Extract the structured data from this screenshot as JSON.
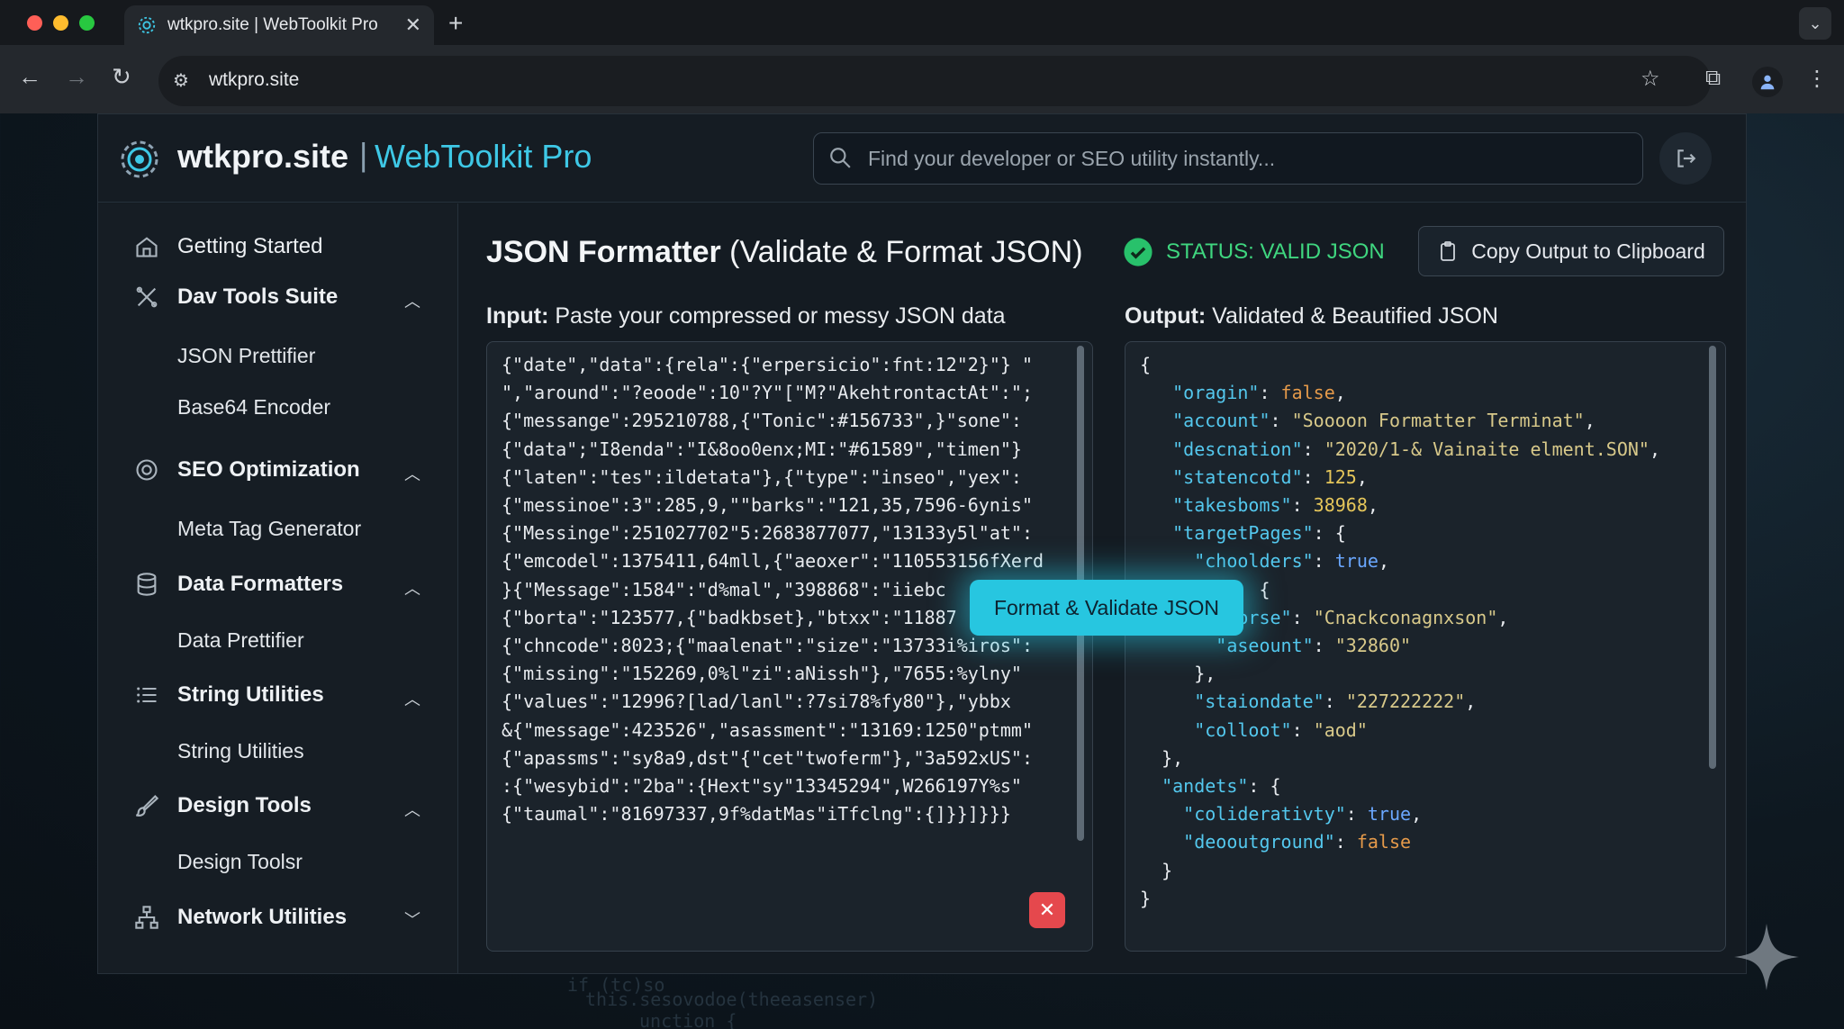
{
  "browser": {
    "tab_title": "wtkpro.site | WebToolkit Pro",
    "url": "wtkpro.site"
  },
  "header": {
    "brand": "wtkpro.site",
    "brand_sep": "|",
    "brand_sub": "WebToolkit Pro",
    "search_placeholder": "Find your developer or SEO utility instantly..."
  },
  "sidebar": {
    "getting_started": "Getting Started",
    "dav_tools": "Dav Tools Suite",
    "json_prettifier": "JSON Prettifier",
    "base64_encoder": "Base64 Encoder",
    "seo": "SEO Optimization",
    "meta_tag": "Meta Tag Generator",
    "data_formatters": "Data Formatters",
    "data_prettifier": "Data Prettifier",
    "string_utilities": "String Utilities",
    "string_utilities_sub": "String Utilities",
    "design_tools": "Design Tools",
    "design_toolsr": "Design Toolsr",
    "network_utilities": "Network Utilities"
  },
  "main": {
    "title_bold": "JSON Formatter",
    "title_rest": " (Validate & Format JSON)",
    "status": "STATUS: VALID JSON",
    "copy_button": "Copy Output to Clipboard",
    "input_label_bold": "Input:",
    "input_label_rest": " Paste your compressed or messy JSON data",
    "output_label_bold": "Output:",
    "output_label_rest": " Validated & Beautified JSON",
    "format_button": "Format & Validate JSON",
    "input_text": "{\"date\",\"data\":{rela\":{\"erpersicio\":fnt:12\"2}\"} \"\n\",\"around\":\"?eoode\":10\"?Y\"[\"M?\"AkehtrontactAt\":\";\n{\"messange\":295210788,{\"Tonic\":#156733\",}\"sone\":\n{\"data\";\"I8enda\":\"I&8oo0enx;MI:\"#61589\",\"timen\"}\n{\"laten\":\"tes\":ildetata\"},{\"type\":\"inseo\",\"yex\":\n{\"messinoe\":3\":285,9,\"\"barks\":\"121,35,7596-6ynis\"\n{\"Messinge\":251027702\"5:2683877077,\"13133y5l\"at\":\n{\"emcodel\":1375411,64mll,{\"aeoxer\":\"110553156fXerd\n}{\"Message\":1584\":\"d%mal\",\"398868\":\"iiebc\n{\"borta\":\"123577,{\"badkbset},\"btxx\":\"11887\n{\"chncode\":8023;{\"maalenat\":\"size\":\"13733i%iros\":\n{\"missing\":\"152269,0%l\"zi\":aNissh\"},\"7655:%ylny\"\n{\"values\":\"12996?[lad/lanl\":?7si78%fy80\"},\"ybbx\n&{\"message\":423526\",\"asassment\":\"13169:1250\"ptmm\"\n{\"apassms\":\"sy8a9,dst\"{\"cet\"twoferm\"},\"3a592xUS\":\n:{\"wesybid\":\"2ba\":{Hext\"sy\"13345294\",W266197Y%s\"\n{\"taumal\":\"81697337,9f%datMas\"iTfclng\":{]}}]}}}",
    "output_lines": [
      [
        [
          "p",
          "{"
        ]
      ],
      [
        [
          "p",
          "   "
        ],
        [
          "k",
          "\"oragin\""
        ],
        [
          "p",
          ": "
        ],
        [
          "b",
          "false"
        ],
        [
          "p",
          ","
        ]
      ],
      [
        [
          "p",
          "   "
        ],
        [
          "k",
          "\"account\""
        ],
        [
          "p",
          ": "
        ],
        [
          "s",
          "\"Soooon Formatter Terminat\""
        ],
        [
          "p",
          ","
        ]
      ],
      [
        [
          "p",
          "   "
        ],
        [
          "k",
          "\"descnation\""
        ],
        [
          "p",
          ": "
        ],
        [
          "s",
          "\"2020/1-& Vainaite elment.SON\""
        ],
        [
          "p",
          ","
        ]
      ],
      [
        [
          "p",
          "   "
        ],
        [
          "k",
          "\"statencotd\""
        ],
        [
          "p",
          ": "
        ],
        [
          "n",
          "125"
        ],
        [
          "p",
          ","
        ]
      ],
      [
        [
          "p",
          "   "
        ],
        [
          "k",
          "\"takesboms\""
        ],
        [
          "p",
          ": "
        ],
        [
          "n",
          "38968"
        ],
        [
          "p",
          ","
        ]
      ],
      [
        [
          "p",
          "   "
        ],
        [
          "k",
          "\"targetPages\""
        ],
        [
          "p",
          ": {"
        ]
      ],
      [
        [
          "p",
          "     "
        ],
        [
          "k",
          "\"choolders\""
        ],
        [
          "p",
          ": "
        ],
        [
          "t",
          "true"
        ],
        [
          "p",
          ","
        ]
      ],
      [
        [
          "p",
          "           {"
        ]
      ],
      [
        [
          "p",
          "       "
        ],
        [
          "k",
          "\"korse\""
        ],
        [
          "p",
          ": "
        ],
        [
          "s",
          "\"Cnackconagnxson\""
        ],
        [
          "p",
          ","
        ]
      ],
      [
        [
          "p",
          "       "
        ],
        [
          "k",
          "\"aseount\""
        ],
        [
          "p",
          ": "
        ],
        [
          "s",
          "\"32860\""
        ]
      ],
      [
        [
          "p",
          "     },"
        ]
      ],
      [
        [
          "p",
          "     "
        ],
        [
          "k",
          "\"staiondate\""
        ],
        [
          "p",
          ": "
        ],
        [
          "s",
          "\"227222222\""
        ],
        [
          "p",
          ","
        ]
      ],
      [
        [
          "p",
          "     "
        ],
        [
          "k",
          "\"colloot\""
        ],
        [
          "p",
          ": "
        ],
        [
          "s",
          "\"aod\""
        ]
      ],
      [
        [
          "p",
          "  },"
        ]
      ],
      [
        [
          "p",
          "  "
        ],
        [
          "k",
          "\"andets\""
        ],
        [
          "p",
          ": {"
        ]
      ],
      [
        [
          "p",
          "    "
        ],
        [
          "k",
          "\"coliderativty\""
        ],
        [
          "p",
          ": "
        ],
        [
          "t",
          "true"
        ],
        [
          "p",
          ","
        ]
      ],
      [
        [
          "p",
          "    "
        ],
        [
          "k",
          "\"deooutground\""
        ],
        [
          "p",
          ": "
        ],
        [
          "b",
          "false"
        ]
      ],
      [
        [
          "p",
          "  }"
        ]
      ],
      [
        [
          "p",
          "}"
        ]
      ]
    ]
  },
  "background": {
    "code1": "if (tc)so",
    "code2": "this.sesovodoe(theeasenser)",
    "code3": "unction {"
  },
  "colors": {
    "accent": "#27c6e0",
    "valid": "#3fd67f",
    "clear": "#e5484d"
  }
}
